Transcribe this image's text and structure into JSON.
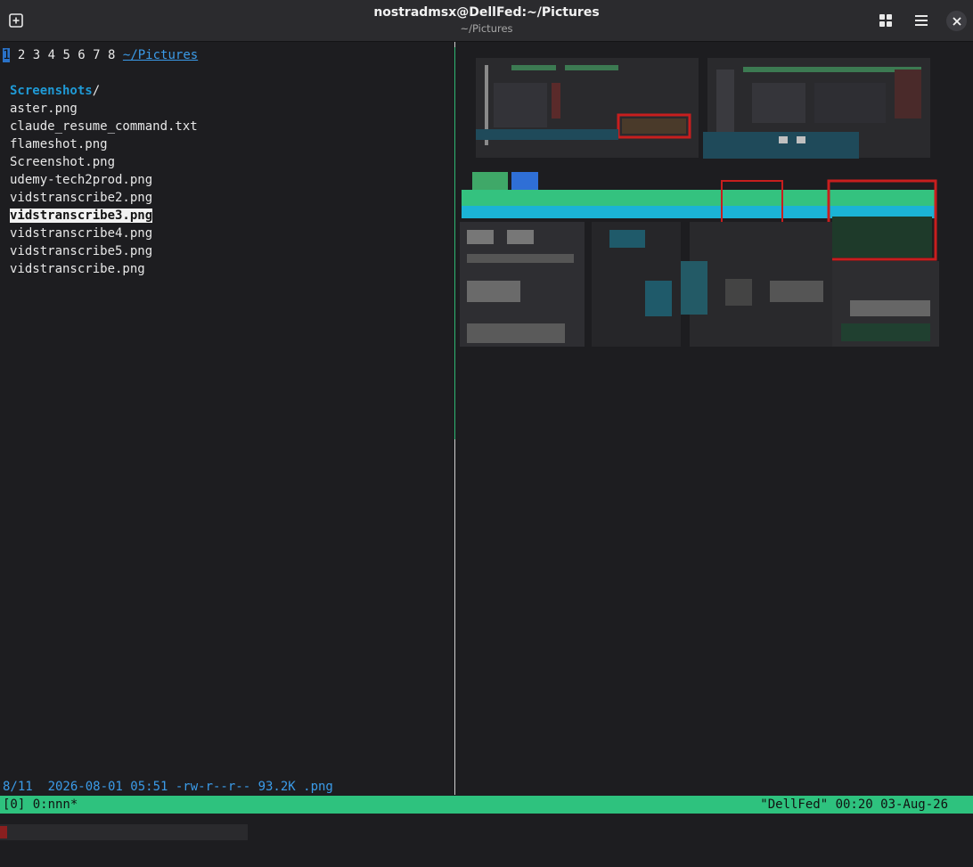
{
  "window": {
    "title": "nostradmsx@DellFed:~/Pictures",
    "subtitle": "~/Pictures",
    "icons": {
      "new_tab": "new-tab-icon",
      "grid": "grid-view-icon",
      "menu": "hamburger-menu-icon",
      "close": "close-icon"
    }
  },
  "nnn": {
    "contexts": {
      "current": "1",
      "others": "2 3 4 5 6 7 8",
      "path": "~/Pictures"
    },
    "entries": [
      {
        "name": "Screenshots",
        "suffix": "/",
        "type": "dir"
      },
      {
        "name": "aster.png",
        "type": "file"
      },
      {
        "name": "claude_resume_command.txt",
        "type": "file"
      },
      {
        "name": "flameshot.png",
        "type": "file"
      },
      {
        "name": "Screenshot.png",
        "type": "file"
      },
      {
        "name": "udemy-tech2prod.png",
        "type": "file"
      },
      {
        "name": "vidstranscribe2.png",
        "type": "file"
      },
      {
        "name": "vidstranscribe3.png",
        "type": "file",
        "selected": true
      },
      {
        "name": "vidstranscribe4.png",
        "type": "file"
      },
      {
        "name": "vidstranscribe5.png",
        "type": "file"
      },
      {
        "name": "vidstranscribe.png",
        "type": "file"
      }
    ],
    "status_line": "8/11  2026-08-01 05:51 -rw-r--r-- 93.2K .png"
  },
  "tmux": {
    "left": "[0] 0:nnn*",
    "right": "\"DellFed\" 00:20 03-Aug-26"
  },
  "colors": {
    "accent_blue": "#2a72c8",
    "dir_blue": "#1f9ad6",
    "tmux_green": "#2ec27e"
  }
}
